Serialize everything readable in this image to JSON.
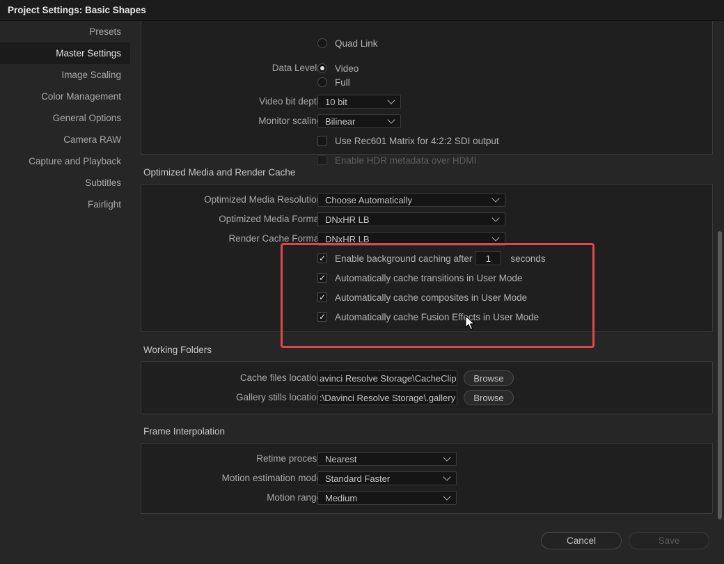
{
  "window": {
    "title": "Project Settings:  Basic Shapes"
  },
  "sidebar": {
    "items": [
      {
        "label": "Presets"
      },
      {
        "label": "Master Settings"
      },
      {
        "label": "Image Scaling"
      },
      {
        "label": "Color Management"
      },
      {
        "label": "General Options"
      },
      {
        "label": "Camera RAW"
      },
      {
        "label": "Capture and Playback"
      },
      {
        "label": "Subtitles"
      },
      {
        "label": "Fairlight"
      }
    ],
    "active_index": 1
  },
  "video": {
    "quad_link": "Quad Link",
    "data_levels_label": "Data Levels",
    "data_levels_video": "Video",
    "data_levels_full": "Full",
    "bit_depth_label": "Video bit depth",
    "bit_depth_value": "10 bit",
    "monitor_scaling_label": "Monitor scaling",
    "monitor_scaling_value": "Bilinear",
    "rec601_label": "Use Rec601 Matrix for 4:2:2 SDI output",
    "hdr_label": "Enable HDR metadata over HDMI"
  },
  "optimized": {
    "title": "Optimized Media and Render Cache",
    "resolution_label": "Optimized Media Resolution",
    "resolution_value": "Choose Automatically",
    "format_label": "Optimized Media Format",
    "format_value": "DNxHR LB",
    "render_format_label": "Render Cache Format",
    "render_format_value": "DNxHR LB",
    "bg_cache_label": "Enable background caching after",
    "bg_cache_seconds": "1",
    "bg_cache_unit": "seconds",
    "cache_transitions": "Automatically cache transitions in User Mode",
    "cache_composites": "Automatically cache composites in User Mode",
    "cache_fusion": "Automatically cache Fusion Effects in User Mode"
  },
  "folders": {
    "title": "Working Folders",
    "cache_label": "Cache files location",
    "cache_value": "avinci Resolve Storage\\CacheClip",
    "gallery_label": "Gallery stills location",
    "gallery_value": ":\\Davinci Resolve Storage\\.gallery",
    "browse": "Browse"
  },
  "interp": {
    "title": "Frame Interpolation",
    "retime_label": "Retime process",
    "retime_value": "Nearest",
    "motion_label": "Motion estimation mode",
    "motion_value": "Standard Faster",
    "range_label": "Motion range",
    "range_value": "Medium"
  },
  "footer": {
    "cancel": "Cancel",
    "save": "Save"
  },
  "colors": {
    "highlight": "#e04848",
    "background": "#262627",
    "panel": "#1f1f20"
  }
}
